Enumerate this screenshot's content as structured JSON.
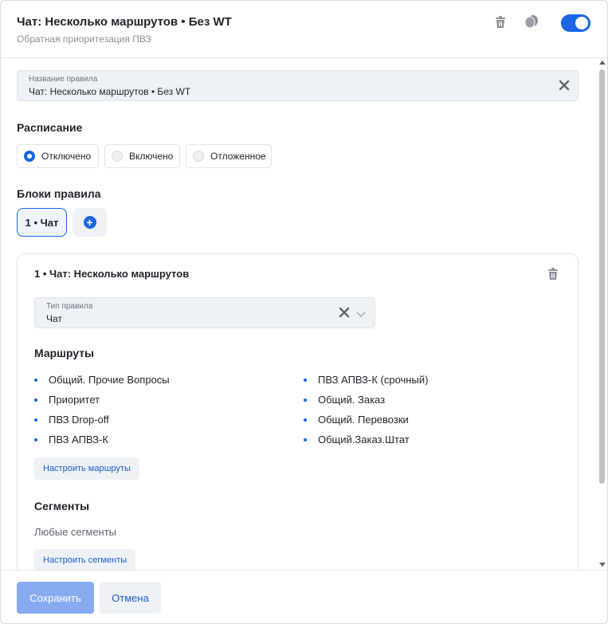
{
  "header": {
    "title": "Чат: Несколько маршрутов • Без WT",
    "subtitle": "Обратная приоритезация ПВЗ",
    "icons": [
      "trash-icon",
      "copy-icon",
      "toggle-switch"
    ],
    "toggle_on": true
  },
  "rule_name": {
    "label": "Название правила",
    "value": "Чат: Несколько маршрутов • Без WT"
  },
  "schedule": {
    "title": "Расписание",
    "options": [
      {
        "label": "Отключено",
        "selected": true
      },
      {
        "label": "Включено",
        "selected": false
      },
      {
        "label": "Отложенное",
        "selected": false
      }
    ]
  },
  "blocks": {
    "title": "Блоки правила",
    "tabs": [
      {
        "label": "1 • Чат",
        "active": true
      }
    ],
    "add_icon": "plus-icon"
  },
  "block_card": {
    "title": "1 • Чат: Несколько маршрутов",
    "type_field": {
      "label": "Тип правила",
      "value": "Чат"
    },
    "routes_title": "Маршруты",
    "routes_left": [
      "Общий. Прочие Вопросы",
      "Приоритет",
      "ПВЗ Drop-off",
      "ПВЗ АПВЗ-К"
    ],
    "routes_right": [
      "ПВЗ АПВЗ-К (срочный)",
      "Общий. Заказ",
      "Общий. Перевозки",
      "Общий.Заказ.Штат"
    ],
    "configure_routes": "Настроить маршруты",
    "segments_title": "Сегменты",
    "segments_value": "Любые сегменты",
    "configure_segments": "Настроить сегменты"
  },
  "footer": {
    "save": "Сохранить",
    "cancel": "Отмена"
  },
  "colors": {
    "accent": "#1a66e6",
    "save_disabled": "#87abf1",
    "field_bg": "#eef1f5"
  }
}
